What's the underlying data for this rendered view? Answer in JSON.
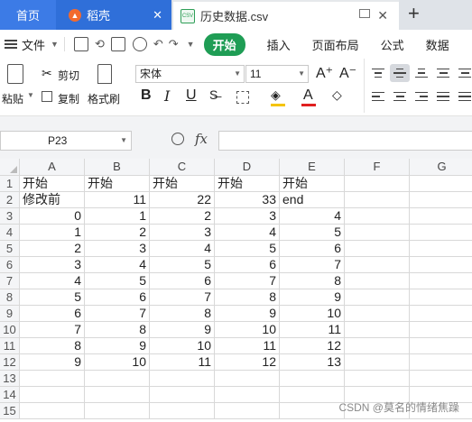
{
  "tabs": {
    "home": "首页",
    "daoke": "稻壳",
    "file": "历史数据.csv",
    "csv_badge": "CSV",
    "new_tab": "+"
  },
  "menu": {
    "file": "文件",
    "items": [
      "开始",
      "插入",
      "页面布局",
      "公式",
      "数据"
    ],
    "active_color": "#1f9d55"
  },
  "ribbon": {
    "paste": "粘贴",
    "cut": "剪切",
    "copy": "复制",
    "format_painter": "格式刷",
    "font_name": "宋体",
    "font_size": "11",
    "grow": "A⁺",
    "shrink": "A⁻",
    "bold": "B",
    "italic": "I",
    "underline": "U",
    "font_color_letter": "A"
  },
  "formula_bar": {
    "cell_ref": "P23",
    "fx": "fx",
    "content": ""
  },
  "sheet": {
    "columns": [
      "A",
      "B",
      "C",
      "D",
      "E",
      "F",
      "G"
    ],
    "rows": [
      "1",
      "2",
      "3",
      "4",
      "5",
      "6",
      "7",
      "8",
      "9",
      "10",
      "11",
      "12",
      "13",
      "14",
      "15"
    ],
    "cells": [
      [
        "开始",
        "开始",
        "开始",
        "开始",
        "开始"
      ],
      [
        "修改前",
        "11",
        "22",
        "33",
        "end"
      ],
      [
        "0",
        "1",
        "2",
        "3",
        "4"
      ],
      [
        "1",
        "2",
        "3",
        "4",
        "5"
      ],
      [
        "2",
        "3",
        "4",
        "5",
        "6"
      ],
      [
        "3",
        "4",
        "5",
        "6",
        "7"
      ],
      [
        "4",
        "5",
        "6",
        "7",
        "8"
      ],
      [
        "5",
        "6",
        "7",
        "8",
        "9"
      ],
      [
        "6",
        "7",
        "8",
        "9",
        "10"
      ],
      [
        "7",
        "8",
        "9",
        "10",
        "11"
      ],
      [
        "8",
        "9",
        "10",
        "11",
        "12"
      ],
      [
        "9",
        "10",
        "11",
        "12",
        "13"
      ]
    ]
  },
  "watermark": "CSDN @莫名的情绪焦躁"
}
